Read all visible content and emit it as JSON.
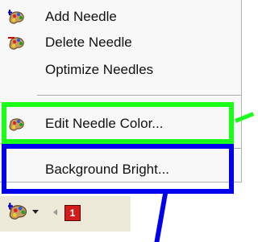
{
  "menu": {
    "items": [
      {
        "label": "Add Needle",
        "icon": "add-needle-icon"
      },
      {
        "label": "Delete Needle",
        "icon": "delete-needle-icon"
      },
      {
        "label": "Optimize Needles",
        "icon": ""
      },
      {
        "label": "Edit Needle Color...",
        "icon": "palette-icon"
      },
      {
        "label": "Background Bright...",
        "icon": ""
      }
    ]
  },
  "toolbar": {
    "badge": "1",
    "icon": "palette-icon"
  },
  "colors": {
    "green_highlight": "#19ff19",
    "blue_highlight": "#0000ee",
    "toolbar_bg": "#ece9d8"
  }
}
